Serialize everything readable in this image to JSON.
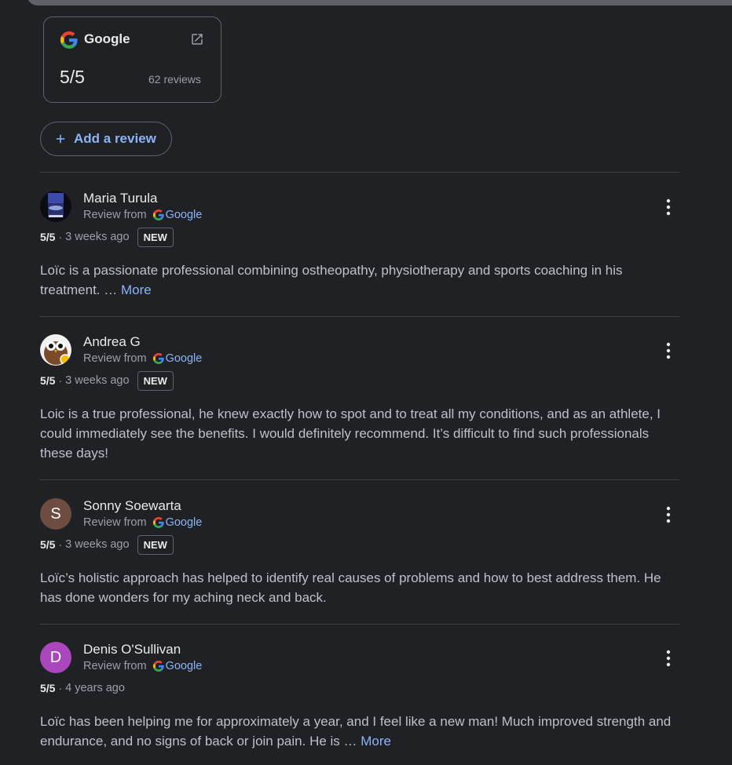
{
  "source_card": {
    "name": "Google",
    "rating": "5/5",
    "review_count": "62 reviews"
  },
  "add_review_label": "Add a review",
  "review_from_label": "Review from",
  "google_label": "Google",
  "new_label": "NEW",
  "more_label": "More",
  "reviews": [
    {
      "name": "Maria Turula",
      "rating": "5/5",
      "time": "3 weeks ago",
      "is_new": true,
      "text": "Loïc is a passionate professional combining ostheopathy, physiotherapy and sports coaching in his treatment. …",
      "truncated": true,
      "avatar": "photo"
    },
    {
      "name": "Andrea G",
      "rating": "5/5",
      "time": "3 weeks ago",
      "is_new": true,
      "text": "Loic is a true professional, he knew exactly how to spot and to treat all my conditions, and as an athlete, I could immediately see the benefits. I would definitely recommend. It’s difficult to find such professionals these days!",
      "truncated": false,
      "avatar": "owl"
    },
    {
      "name": "Sonny Soewarta",
      "rating": "5/5",
      "time": "3 weeks ago",
      "is_new": true,
      "text": "Loïc’s holistic approach has helped to identify real causes of problems and how to best address them. He has done wonders for my aching neck and back.",
      "truncated": false,
      "avatar": "letter",
      "avatar_letter": "S",
      "avatar_color": "#6d4c41"
    },
    {
      "name": "Denis O'Sullivan",
      "rating": "5/5",
      "time": "4 years ago",
      "is_new": false,
      "text": "Loïc has been helping me for approximately a year, and I feel like a new man! Much improved strength and endurance, and no signs of back or join pain. He is …",
      "truncated": true,
      "avatar": "letter",
      "avatar_letter": "D",
      "avatar_color": "#ab47bc"
    }
  ],
  "colors": {
    "background": "#202124",
    "link": "#8ab4f8",
    "border": "#5f6368"
  }
}
